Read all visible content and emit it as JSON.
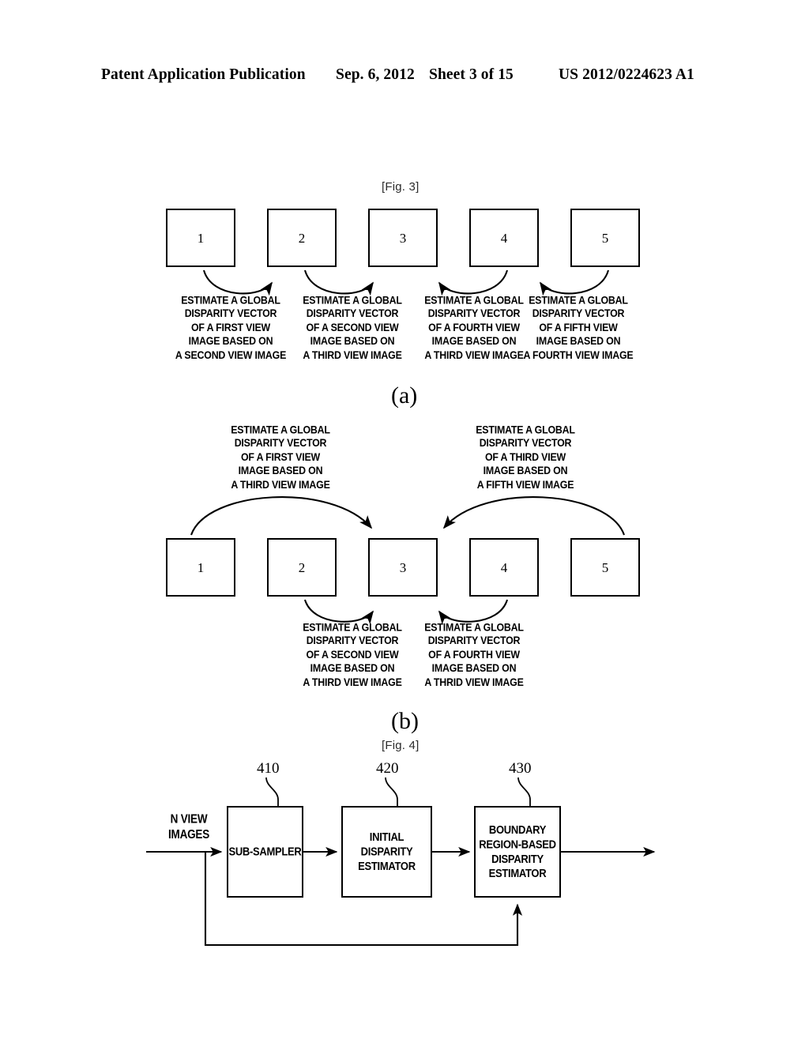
{
  "header": {
    "publication": "Patent Application Publication",
    "date": "Sep. 6, 2012",
    "sheet": "Sheet 3 of 15",
    "patent_number": "US 2012/0224623 A1"
  },
  "figures": [
    {
      "label": "[Fig. 3]",
      "panels": [
        {
          "letter": "(a)",
          "boxes": [
            "1",
            "2",
            "3",
            "4",
            "5"
          ],
          "captions": [
            {
              "lines": [
                "ESTIMATE A GLOBAL",
                "DISPARITY VECTOR",
                "OF A FIRST VIEW",
                "IMAGE BASED ON",
                "A SECOND VIEW IMAGE"
              ],
              "arrow": {
                "from_box": 2,
                "to_box": 1,
                "direction": "right"
              }
            },
            {
              "lines": [
                "ESTIMATE A GLOBAL",
                "DISPARITY VECTOR",
                "OF A SECOND VIEW",
                "IMAGE BASED ON",
                "A THIRD VIEW IMAGE"
              ],
              "arrow": {
                "from_box": 3,
                "to_box": 2,
                "direction": "right"
              }
            },
            {
              "lines": [
                "ESTIMATE A GLOBAL",
                "DISPARITY VECTOR",
                "OF A FOURTH VIEW",
                "IMAGE BASED ON",
                "A THIRD VIEW IMAGE"
              ],
              "arrow": {
                "from_box": 3,
                "to_box": 4,
                "direction": "left"
              }
            },
            {
              "lines": [
                "ESTIMATE A GLOBAL",
                "DISPARITY VECTOR",
                "OF A FIFTH VIEW",
                "IMAGE BASED ON",
                "A FOURTH VIEW IMAGE"
              ],
              "arrow": {
                "from_box": 4,
                "to_box": 5,
                "direction": "left"
              }
            }
          ]
        },
        {
          "letter": "(b)",
          "boxes": [
            "1",
            "2",
            "3",
            "4",
            "5"
          ],
          "captions_above": [
            {
              "lines": [
                "ESTIMATE A GLOBAL",
                "DISPARITY VECTOR",
                "OF A FIRST VIEW",
                "IMAGE BASED ON",
                "A THIRD VIEW IMAGE"
              ],
              "arrow": {
                "from_box": 3,
                "to_box": 1,
                "direction": "right"
              }
            },
            {
              "lines": [
                "ESTIMATE A GLOBAL",
                "DISPARITY VECTOR",
                "OF A THIRD VIEW",
                "IMAGE BASED ON",
                "A FIFTH VIEW IMAGE"
              ],
              "arrow": {
                "from_box": 5,
                "to_box": 3,
                "direction": "left"
              }
            }
          ],
          "captions_below": [
            {
              "lines": [
                "ESTIMATE A GLOBAL",
                "DISPARITY VECTOR",
                "OF A SECOND VIEW",
                "IMAGE BASED ON",
                "A THIRD VIEW IMAGE"
              ],
              "arrow": {
                "from_box": 3,
                "to_box": 2,
                "direction": "right"
              }
            },
            {
              "lines": [
                "ESTIMATE A GLOBAL",
                "DISPARITY VECTOR",
                "OF A FOURTH VIEW",
                "IMAGE BASED ON",
                "A THRID VIEW IMAGE"
              ],
              "arrow": {
                "from_box": 3,
                "to_box": 4,
                "direction": "left"
              }
            }
          ]
        }
      ]
    },
    {
      "label": "[Fig. 4]",
      "input_label": {
        "lines": [
          "N VIEW",
          "IMAGES"
        ]
      },
      "blocks": [
        {
          "ref": "410",
          "lines": [
            "SUB-SAMPLER"
          ]
        },
        {
          "ref": "420",
          "lines": [
            "INITIAL DISPARITY",
            "ESTIMATOR"
          ]
        },
        {
          "ref": "430",
          "lines": [
            "BOUNDARY",
            "REGION-BASED",
            "DISPARITY",
            "ESTIMATOR"
          ]
        }
      ]
    }
  ],
  "colors": {
    "ink": "#000000",
    "paper": "#ffffff",
    "fig_label": "#2b2b2b"
  }
}
